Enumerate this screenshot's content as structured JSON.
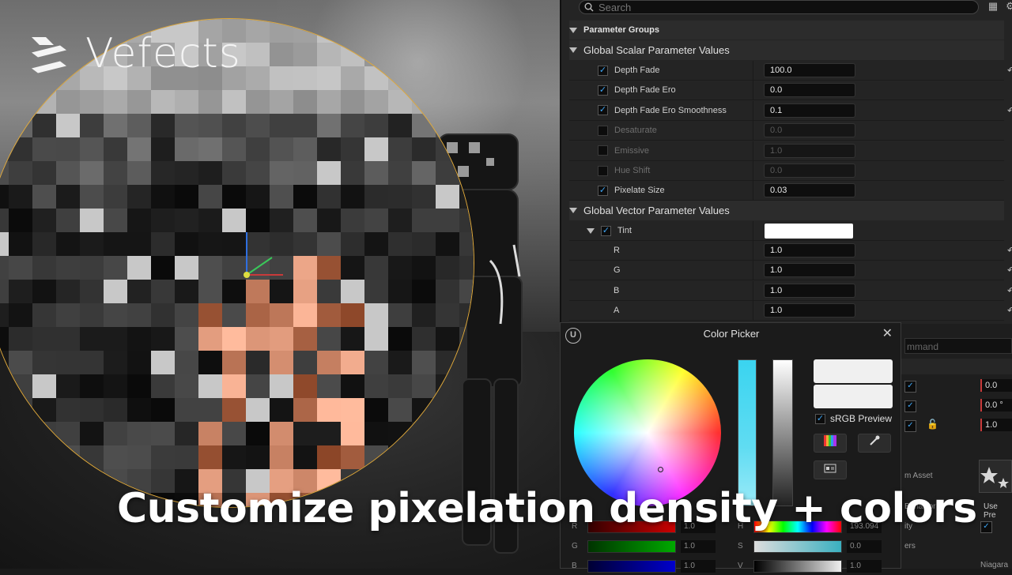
{
  "brand": {
    "name": "Vefects"
  },
  "caption": "Customize pixelation density + colors",
  "details_panel": {
    "search_placeholder": "Search",
    "groups_header": "Parameter Groups",
    "scalar_group": {
      "title": "Global Scalar Parameter Values",
      "params": [
        {
          "label": "Depth Fade",
          "value": "100.0",
          "enabled": true
        },
        {
          "label": "Depth Fade Ero",
          "value": "0.0",
          "enabled": true
        },
        {
          "label": "Depth Fade Ero Smoothness",
          "value": "0.1",
          "enabled": true
        },
        {
          "label": "Desaturate",
          "value": "0.0",
          "enabled": false
        },
        {
          "label": "Emissive",
          "value": "1.0",
          "enabled": false
        },
        {
          "label": "Hue Shift",
          "value": "0.0",
          "enabled": false
        },
        {
          "label": "Pixelate Size",
          "value": "0.03",
          "enabled": true
        }
      ]
    },
    "vector_group": {
      "title": "Global Vector Parameter Values",
      "tint": {
        "label": "Tint",
        "color": "#ffffff",
        "enabled": true
      },
      "channels": [
        {
          "label": "R",
          "value": "1.0"
        },
        {
          "label": "G",
          "value": "1.0"
        },
        {
          "label": "B",
          "value": "1.0"
        },
        {
          "label": "A",
          "value": "1.0"
        }
      ]
    }
  },
  "color_picker": {
    "title": "Color Picker",
    "srgb_label": "sRGB Preview",
    "srgb_checked": true,
    "channels": [
      {
        "label": "R",
        "value": "1.0"
      },
      {
        "label": "G",
        "value": "1.0"
      },
      {
        "label": "B",
        "value": "1.0"
      },
      {
        "label": "H",
        "value": "193.094"
      },
      {
        "label": "S",
        "value": "0.0"
      },
      {
        "label": "V",
        "value": "1.0"
      }
    ]
  },
  "side_strip": {
    "command_placeholder": "mmand",
    "values": [
      "0.0",
      "0.0 °",
      "1.0"
    ],
    "labels": [
      "m Asset",
      "Behavior",
      "ity",
      "ers"
    ],
    "use_pre": "Use Pre",
    "niagara": "Niagara"
  },
  "colors": {
    "accent_check": "#3da5f5",
    "circle_outline": "#e0a93a"
  }
}
